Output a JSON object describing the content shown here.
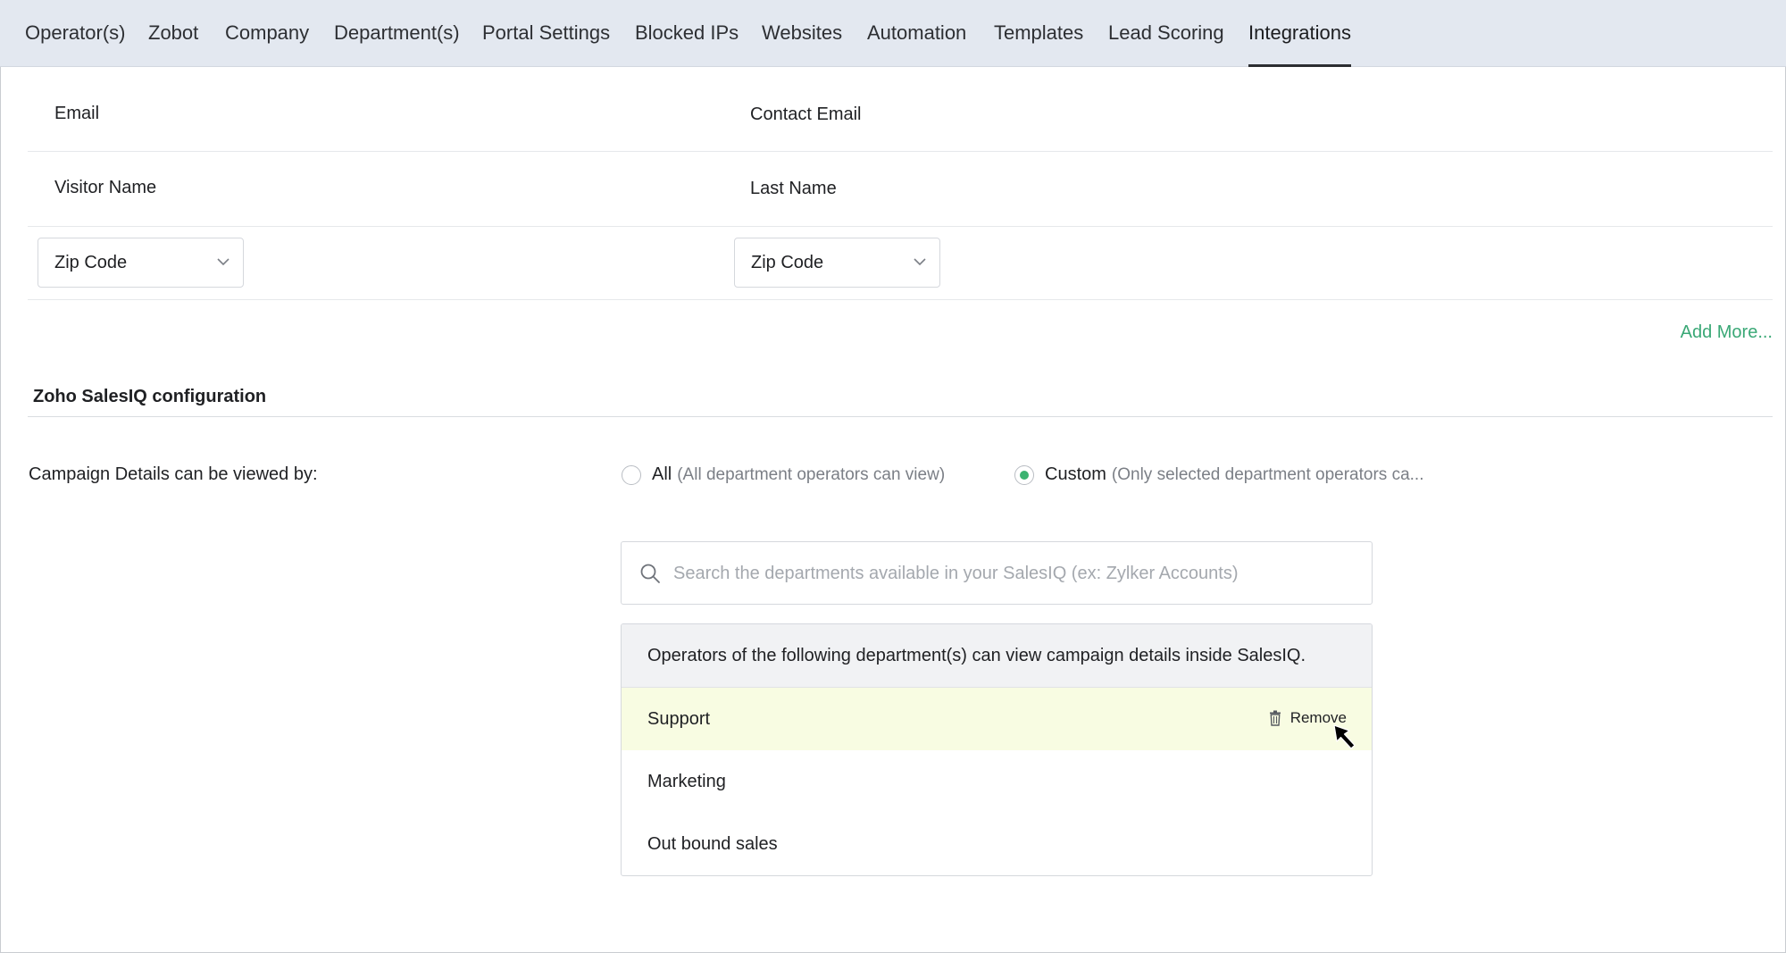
{
  "tabs": [
    {
      "label": "Operator(s)"
    },
    {
      "label": "Zobot"
    },
    {
      "label": "Company"
    },
    {
      "label": "Department(s)"
    },
    {
      "label": "Portal Settings"
    },
    {
      "label": "Blocked IPs"
    },
    {
      "label": "Websites"
    },
    {
      "label": "Automation"
    },
    {
      "label": "Templates"
    },
    {
      "label": "Lead Scoring"
    },
    {
      "label": "Integrations",
      "active": true
    }
  ],
  "mapping": {
    "rows": [
      {
        "left": "Email",
        "right": "Contact Email"
      },
      {
        "left": "Visitor Name",
        "right": "Last Name"
      }
    ],
    "select_left": {
      "value": "Zip Code"
    },
    "select_right": {
      "value": "Zip Code"
    },
    "add_more": "Add More..."
  },
  "salesiq": {
    "title": "Zoho SalesIQ configuration",
    "campaign_label": "Campaign Details can be viewed by:",
    "radio_all": {
      "label": "All",
      "sub": "(All department operators can view)",
      "checked": false
    },
    "radio_custom": {
      "label": "Custom",
      "sub": "(Only selected department operators ca...",
      "checked": true
    },
    "search_placeholder": "Search the departments available in your SalesIQ (ex: Zylker Accounts)",
    "dept_header": "Operators of the following department(s) can view campaign details inside SalesIQ.",
    "departments": [
      {
        "name": "Support",
        "highlighted": true
      },
      {
        "name": "Marketing"
      },
      {
        "name": "Out bound sales"
      }
    ],
    "remove_label": "Remove"
  },
  "colors": {
    "tabbar_bg": "#e3e8f0",
    "accent_green": "#3aa876",
    "highlight_row": "#f8fce2"
  },
  "icons": [
    "chevron-down-icon",
    "search-icon",
    "trash-icon",
    "cursor-arrow-icon"
  ]
}
